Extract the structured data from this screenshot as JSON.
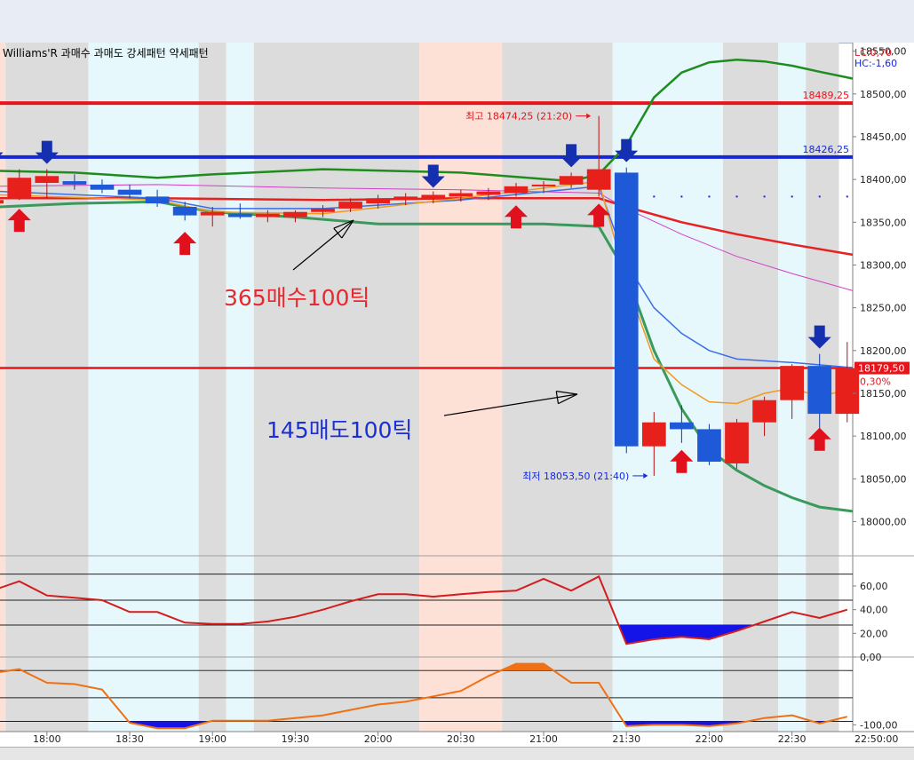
{
  "chart_data": [
    {
      "type": "candlestick",
      "indicator_title": "Williams'R 과매수 과매도 강세패턴  약세패턴",
      "top_right_info": [
        "LC:0,70",
        "HC:-1,60"
      ],
      "y_ticks": [
        "18550,00",
        "18500,00",
        "18450,00",
        "18400,00",
        "18350,00",
        "18300,00",
        "18250,00",
        "18200,00",
        "18150,00",
        "18100,00",
        "18050,00",
        "18000,00"
      ],
      "y_tick_values": [
        18550,
        18500,
        18450,
        18400,
        18350,
        18300,
        18250,
        18200,
        18150,
        18100,
        18050,
        18000
      ],
      "ylim": [
        17960,
        18560
      ],
      "x_ticks": [
        "18:00",
        "18:30",
        "19:00",
        "19:30",
        "20:00",
        "20:30",
        "21:00",
        "21:30",
        "22:00",
        "22:30",
        "22:50:00"
      ],
      "x_tick_times": [
        "18:00",
        "18:30",
        "19:00",
        "19:30",
        "20:00",
        "20:30",
        "21:00",
        "21:30",
        "22:00",
        "22:30"
      ],
      "xlim": [
        "17:43",
        "22:52"
      ],
      "candle_interval_min": 10,
      "candles": [
        {
          "t": "17:40",
          "o": 18372,
          "h": 18382,
          "l": 18366,
          "c": 18376
        },
        {
          "t": "17:50",
          "o": 18378,
          "h": 18412,
          "l": 18376,
          "c": 18402
        },
        {
          "t": "18:00",
          "o": 18396,
          "h": 18412,
          "l": 18378,
          "c": 18404
        },
        {
          "t": "18:10",
          "o": 18398,
          "h": 18406,
          "l": 18388,
          "c": 18394
        },
        {
          "t": "18:20",
          "o": 18394,
          "h": 18400,
          "l": 18384,
          "c": 18388
        },
        {
          "t": "18:30",
          "o": 18388,
          "h": 18394,
          "l": 18378,
          "c": 18382
        },
        {
          "t": "18:40",
          "o": 18380,
          "h": 18388,
          "l": 18368,
          "c": 18372
        },
        {
          "t": "18:50",
          "o": 18368,
          "h": 18374,
          "l": 18352,
          "c": 18358
        },
        {
          "t": "19:00",
          "o": 18358,
          "h": 18368,
          "l": 18345,
          "c": 18362
        },
        {
          "t": "19:10",
          "o": 18360,
          "h": 18372,
          "l": 18354,
          "c": 18356
        },
        {
          "t": "19:20",
          "o": 18356,
          "h": 18364,
          "l": 18350,
          "c": 18360
        },
        {
          "t": "19:30",
          "o": 18356,
          "h": 18364,
          "l": 18350,
          "c": 18362
        },
        {
          "t": "19:40",
          "o": 18362,
          "h": 18370,
          "l": 18356,
          "c": 18366
        },
        {
          "t": "19:50",
          "o": 18366,
          "h": 18378,
          "l": 18362,
          "c": 18374
        },
        {
          "t": "20:00",
          "o": 18372,
          "h": 18382,
          "l": 18366,
          "c": 18378
        },
        {
          "t": "20:10",
          "o": 18376,
          "h": 18384,
          "l": 18370,
          "c": 18380
        },
        {
          "t": "20:20",
          "o": 18378,
          "h": 18386,
          "l": 18372,
          "c": 18382
        },
        {
          "t": "20:30",
          "o": 18380,
          "h": 18388,
          "l": 18374,
          "c": 18384
        },
        {
          "t": "20:40",
          "o": 18382,
          "h": 18390,
          "l": 18376,
          "c": 18386
        },
        {
          "t": "20:50",
          "o": 18384,
          "h": 18396,
          "l": 18380,
          "c": 18392
        },
        {
          "t": "21:00",
          "o": 18392,
          "h": 18398,
          "l": 18384,
          "c": 18394
        },
        {
          "t": "21:10",
          "o": 18394,
          "h": 18408,
          "l": 18390,
          "c": 18404
        },
        {
          "t": "21:20",
          "o": 18388,
          "h": 18474.25,
          "l": 18380,
          "c": 18412
        },
        {
          "t": "21:30",
          "o": 18408,
          "h": 18414,
          "l": 18080,
          "c": 18088
        },
        {
          "t": "21:40",
          "o": 18088,
          "h": 18128,
          "l": 18053.5,
          "c": 18116
        },
        {
          "t": "21:50",
          "o": 18116,
          "h": 18136,
          "l": 18092,
          "c": 18108
        },
        {
          "t": "22:00",
          "o": 18108,
          "h": 18114,
          "l": 18066,
          "c": 18070
        },
        {
          "t": "22:10",
          "o": 18068,
          "h": 18120,
          "l": 18062,
          "c": 18116
        },
        {
          "t": "22:20",
          "o": 18116,
          "h": 18146,
          "l": 18100,
          "c": 18142
        },
        {
          "t": "22:30",
          "o": 18142,
          "h": 18184,
          "l": 18120,
          "c": 18182
        },
        {
          "t": "22:40",
          "o": 18182,
          "h": 18196,
          "l": 18106,
          "c": 18126
        },
        {
          "t": "22:50",
          "o": 18126,
          "h": 18210,
          "l": 18116,
          "c": 18179.5
        }
      ],
      "horizontal_lines": [
        {
          "label": "18489,25",
          "value": 18489.25,
          "color": "#e8141c"
        },
        {
          "label": "18426,25",
          "value": 18426.25,
          "color": "#1428d8"
        },
        {
          "label": "18179,50",
          "value": 18179.5,
          "color": "#e8141c"
        }
      ],
      "current_price_change": "0,30%",
      "high_annotation": {
        "text": "최고 18474,25 (21:20)",
        "t": "21:20",
        "value": 18474.25
      },
      "low_annotation": {
        "text": "최저 18053,50 (21:40)",
        "t": "21:40",
        "value": 18053.5
      },
      "buy_signals": [
        {
          "t": "17:50",
          "value": 18372
        },
        {
          "t": "18:50",
          "value": 18345
        },
        {
          "t": "20:50",
          "value": 18376
        },
        {
          "t": "21:20",
          "value": 18378
        },
        {
          "t": "21:50",
          "value": 18090
        },
        {
          "t": "22:40",
          "value": 18116
        }
      ],
      "sell_signals": [
        {
          "t": "17:40",
          "value": 18412
        },
        {
          "t": "18:00",
          "value": 18412
        },
        {
          "t": "20:20",
          "value": 18384
        },
        {
          "t": "21:10",
          "value": 18408
        },
        {
          "t": "21:30",
          "value": 18414
        },
        {
          "t": "22:40",
          "value": 18196
        }
      ],
      "upper_band": {
        "color": "#1e8c1e",
        "points": [
          [
            "17:43",
            18410
          ],
          [
            "18:10",
            18408
          ],
          [
            "18:40",
            18402
          ],
          [
            "19:00",
            18406
          ],
          [
            "19:40",
            18412
          ],
          [
            "20:30",
            18408
          ],
          [
            "21:10",
            18398
          ],
          [
            "21:20",
            18406
          ],
          [
            "21:30",
            18440
          ],
          [
            "21:40",
            18496
          ],
          [
            "21:50",
            18525
          ],
          [
            "22:00",
            18537
          ],
          [
            "22:10",
            18540
          ],
          [
            "22:20",
            18538
          ],
          [
            "22:30",
            18533
          ],
          [
            "22:40",
            18526
          ],
          [
            "22:52",
            18518
          ]
        ]
      },
      "lower_band": {
        "color": "#3a9a5c",
        "points": [
          [
            "17:43",
            18368
          ],
          [
            "18:10",
            18372
          ],
          [
            "18:40",
            18374
          ],
          [
            "19:00",
            18362
          ],
          [
            "19:30",
            18356
          ],
          [
            "20:00",
            18348
          ],
          [
            "20:30",
            18348
          ],
          [
            "21:00",
            18348
          ],
          [
            "21:20",
            18345
          ],
          [
            "21:30",
            18290
          ],
          [
            "21:40",
            18200
          ],
          [
            "21:50",
            18132
          ],
          [
            "22:00",
            18084
          ],
          [
            "22:10",
            18060
          ],
          [
            "22:20",
            18042
          ],
          [
            "22:30",
            18028
          ],
          [
            "22:40",
            18017
          ],
          [
            "22:52",
            18012
          ]
        ]
      },
      "ma_red": {
        "color": "#e82020",
        "points": [
          [
            "17:43",
            18378
          ],
          [
            "18:40",
            18378
          ],
          [
            "19:40",
            18376
          ],
          [
            "20:30",
            18378
          ],
          [
            "21:20",
            18378
          ],
          [
            "21:30",
            18368
          ],
          [
            "21:50",
            18350
          ],
          [
            "22:10",
            18336
          ],
          [
            "22:30",
            18324
          ],
          [
            "22:52",
            18312
          ]
        ]
      },
      "ma_magenta": {
        "color": "#d040c8",
        "points": [
          [
            "17:43",
            18392
          ],
          [
            "18:40",
            18394
          ],
          [
            "19:40",
            18390
          ],
          [
            "20:30",
            18388
          ],
          [
            "21:20",
            18384
          ],
          [
            "21:30",
            18366
          ],
          [
            "21:50",
            18336
          ],
          [
            "22:10",
            18310
          ],
          [
            "22:30",
            18290
          ],
          [
            "22:52",
            18270
          ]
        ]
      },
      "ma_blue": {
        "color": "#3a6ee8",
        "points": [
          [
            "17:43",
            18386
          ],
          [
            "18:40",
            18378
          ],
          [
            "19:00",
            18366
          ],
          [
            "19:40",
            18366
          ],
          [
            "20:30",
            18376
          ],
          [
            "21:20",
            18392
          ],
          [
            "21:30",
            18302
          ],
          [
            "21:40",
            18250
          ],
          [
            "21:50",
            18220
          ],
          [
            "22:00",
            18200
          ],
          [
            "22:10",
            18190
          ],
          [
            "22:30",
            18186
          ],
          [
            "22:52",
            18180
          ]
        ]
      },
      "ma_orange": {
        "color": "#f09a20",
        "points": [
          [
            "17:43",
            18382
          ],
          [
            "18:40",
            18376
          ],
          [
            "19:00",
            18362
          ],
          [
            "19:40",
            18360
          ],
          [
            "20:30",
            18378
          ],
          [
            "21:20",
            18398
          ],
          [
            "21:30",
            18280
          ],
          [
            "21:40",
            18190
          ],
          [
            "21:50",
            18160
          ],
          [
            "22:00",
            18140
          ],
          [
            "22:10",
            18138
          ],
          [
            "22:20",
            18150
          ],
          [
            "22:30",
            18156
          ],
          [
            "22:40",
            18146
          ],
          [
            "22:52",
            18156
          ]
        ]
      },
      "background_shading": [
        {
          "from": "17:40",
          "to": "17:50",
          "kind": "salmon"
        },
        {
          "from": "17:50",
          "to": "18:20",
          "kind": "gray"
        },
        {
          "from": "18:20",
          "to": "19:00",
          "kind": "cyan"
        },
        {
          "from": "19:00",
          "to": "19:10",
          "kind": "gray"
        },
        {
          "from": "19:10",
          "to": "19:20",
          "kind": "cyan"
        },
        {
          "from": "19:20",
          "to": "20:20",
          "kind": "gray"
        },
        {
          "from": "20:20",
          "to": "20:50",
          "kind": "salmon"
        },
        {
          "from": "20:50",
          "to": "21:30",
          "kind": "gray"
        },
        {
          "from": "21:30",
          "to": "22:10",
          "kind": "cyan"
        },
        {
          "from": "22:10",
          "to": "22:30",
          "kind": "gray"
        },
        {
          "from": "22:30",
          "to": "22:40",
          "kind": "cyan"
        },
        {
          "from": "22:40",
          "to": "22:52",
          "kind": "gray"
        }
      ],
      "annotations": [
        {
          "text": "365매수100틱",
          "color": "#e8282e"
        },
        {
          "text": "145매도100틱",
          "color": "#1a2fd8"
        }
      ]
    },
    {
      "type": "line",
      "panel": "oscillator-1",
      "y_ticks": [
        "60,00",
        "40,00",
        "20,00"
      ],
      "y_tick_values": [
        60,
        40,
        20
      ],
      "ylim": [
        0,
        75
      ],
      "levels": [
        70,
        48,
        27
      ],
      "series_color": "#d41c1c",
      "fill_color": "#1414e8",
      "fill_below": 27,
      "points": [
        [
          "17:40",
          56
        ],
        [
          "17:50",
          64
        ],
        [
          "18:00",
          52
        ],
        [
          "18:10",
          50
        ],
        [
          "18:20",
          48
        ],
        [
          "18:30",
          38
        ],
        [
          "18:40",
          38
        ],
        [
          "18:50",
          29
        ],
        [
          "19:00",
          28
        ],
        [
          "19:10",
          28
        ],
        [
          "19:20",
          30
        ],
        [
          "19:30",
          34
        ],
        [
          "19:40",
          40
        ],
        [
          "19:50",
          47
        ],
        [
          "20:00",
          53
        ],
        [
          "20:10",
          53
        ],
        [
          "20:20",
          51
        ],
        [
          "20:30",
          53
        ],
        [
          "20:40",
          55
        ],
        [
          "20:50",
          56
        ],
        [
          "21:00",
          66
        ],
        [
          "21:10",
          56
        ],
        [
          "21:20",
          68
        ],
        [
          "21:30",
          11
        ],
        [
          "21:40",
          15
        ],
        [
          "21:50",
          17
        ],
        [
          "22:00",
          15
        ],
        [
          "22:10",
          22
        ],
        [
          "22:20",
          30
        ],
        [
          "22:30",
          38
        ],
        [
          "22:40",
          33
        ],
        [
          "22:50",
          40
        ]
      ]
    },
    {
      "type": "line",
      "panel": "oscillator-2",
      "y_ticks": [
        "0,00",
        "-100,00"
      ],
      "y_tick_values": [
        0,
        -100
      ],
      "ylim": [
        -110,
        0
      ],
      "levels": [
        -20,
        -60,
        -95
      ],
      "series_color": "#f07014",
      "fill_above": -20,
      "fill_above_color": "#f07014",
      "fill_below": -95,
      "fill_below_color": "#1414e8",
      "points": [
        [
          "17:40",
          -24
        ],
        [
          "17:50",
          -18
        ],
        [
          "18:00",
          -38
        ],
        [
          "18:10",
          -40
        ],
        [
          "18:20",
          -48
        ],
        [
          "18:30",
          -97
        ],
        [
          "18:40",
          -105
        ],
        [
          "18:50",
          -105
        ],
        [
          "19:00",
          -94
        ],
        [
          "19:10",
          -94
        ],
        [
          "19:20",
          -94
        ],
        [
          "19:30",
          -90
        ],
        [
          "19:40",
          -86
        ],
        [
          "19:50",
          -78
        ],
        [
          "20:00",
          -70
        ],
        [
          "20:10",
          -66
        ],
        [
          "20:20",
          -58
        ],
        [
          "20:30",
          -50
        ],
        [
          "20:40",
          -28
        ],
        [
          "20:50",
          -10
        ],
        [
          "21:00",
          -10
        ],
        [
          "21:10",
          -38
        ],
        [
          "21:20",
          -38
        ],
        [
          "21:30",
          -102
        ],
        [
          "21:40",
          -100
        ],
        [
          "21:50",
          -100
        ],
        [
          "22:00",
          -102
        ],
        [
          "22:10",
          -98
        ],
        [
          "22:20",
          -90
        ],
        [
          "22:30",
          -86
        ],
        [
          "22:40",
          -98
        ],
        [
          "22:50",
          -88
        ]
      ]
    }
  ]
}
